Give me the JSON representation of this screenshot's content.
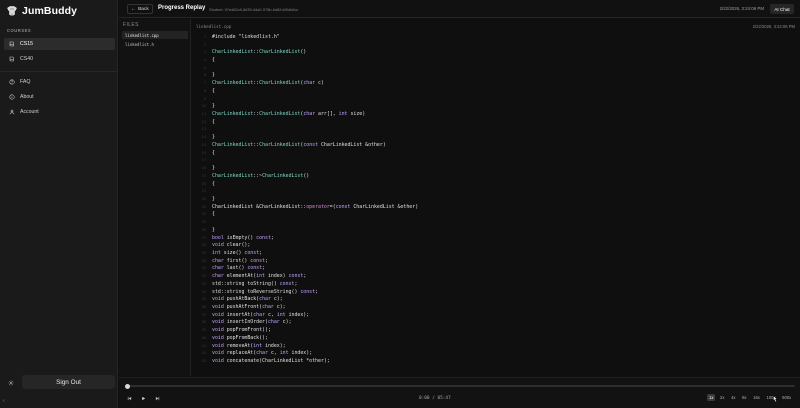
{
  "app": {
    "name": "JumBuddy"
  },
  "sidebar": {
    "section_label": "COURSES",
    "courses": [
      {
        "label": "CS15",
        "icon": "book-icon",
        "active": true
      },
      {
        "label": "CS40",
        "icon": "book-icon",
        "active": false
      }
    ],
    "links": [
      {
        "label": "FAQ",
        "icon": "help-circle-icon"
      },
      {
        "label": "About",
        "icon": "info-icon"
      },
      {
        "label": "Account",
        "icon": "user-icon"
      }
    ],
    "sign_out_label": "Sign Out",
    "settings_icon": "gear-icon",
    "collapse_icon": "chevron-left-icon"
  },
  "header": {
    "back_label": "Back",
    "title": "Progress Replay",
    "student_label": "Student: 97ed62c8-8d35-4da2-978b-bd82d49db8cc",
    "timestamp": "2/22/2026, 3:24:06 PM",
    "ai_chat_label": "AI Chat"
  },
  "files": {
    "label": "FILES",
    "items": [
      {
        "name": "linkedlist.cpp",
        "active": true
      },
      {
        "name": "linkedlist.h",
        "active": false
      }
    ]
  },
  "editor": {
    "filename": "linkedlist.cpp",
    "timestamp": "2/22/2026, 3:24:06 PM",
    "lines": [
      [
        [
          "tx",
          "#include \"linkedlist.h\""
        ]
      ],
      [],
      [
        [
          "ty",
          "CharLinkedList"
        ],
        [
          "tx",
          "::"
        ],
        [
          "ty",
          "CharLinkedList"
        ],
        [
          "tx",
          "()"
        ]
      ],
      [
        [
          "tx",
          "{"
        ]
      ],
      [],
      [
        [
          "tx",
          "}"
        ]
      ],
      [
        [
          "ty",
          "CharLinkedList"
        ],
        [
          "tx",
          "::"
        ],
        [
          "ty",
          "CharLinkedList"
        ],
        [
          "tx",
          "("
        ],
        [
          "kw",
          "char"
        ],
        [
          "tx",
          " c)"
        ]
      ],
      [
        [
          "tx",
          "{"
        ]
      ],
      [],
      [
        [
          "tx",
          "}"
        ]
      ],
      [
        [
          "ty",
          "CharLinkedList"
        ],
        [
          "tx",
          "::"
        ],
        [
          "ty",
          "CharLinkedList"
        ],
        [
          "tx",
          "("
        ],
        [
          "kw",
          "char"
        ],
        [
          "tx",
          " arr[], "
        ],
        [
          "kw",
          "int"
        ],
        [
          "tx",
          " size)"
        ]
      ],
      [
        [
          "tx",
          "{"
        ]
      ],
      [],
      [
        [
          "tx",
          "}"
        ]
      ],
      [
        [
          "ty",
          "CharLinkedList"
        ],
        [
          "tx",
          "::"
        ],
        [
          "ty",
          "CharLinkedList"
        ],
        [
          "tx",
          "("
        ],
        [
          "kw",
          "const"
        ],
        [
          "tx",
          " CharLinkedList &other)"
        ]
      ],
      [
        [
          "tx",
          "{"
        ]
      ],
      [],
      [
        [
          "tx",
          "}"
        ]
      ],
      [
        [
          "ty",
          "CharLinkedList"
        ],
        [
          "tx",
          "::~"
        ],
        [
          "ty",
          "CharLinkedList"
        ],
        [
          "tx",
          "()"
        ]
      ],
      [
        [
          "tx",
          "{"
        ]
      ],
      [],
      [
        [
          "tx",
          "}"
        ]
      ],
      [
        [
          "tx",
          "CharLinkedList &CharLinkedList::"
        ],
        [
          "op",
          "operator"
        ],
        [
          "tx",
          "=("
        ],
        [
          "kw",
          "const"
        ],
        [
          "tx",
          " CharLinkedList &other)"
        ]
      ],
      [
        [
          "tx",
          "{"
        ]
      ],
      [],
      [
        [
          "tx",
          "}"
        ]
      ],
      [
        [
          "kw",
          "bool"
        ],
        [
          "tx",
          " isEmpty() "
        ],
        [
          "kw",
          "const"
        ],
        [
          "tx",
          ";"
        ]
      ],
      [
        [
          "kw",
          "void"
        ],
        [
          "tx",
          " clear();"
        ]
      ],
      [
        [
          "kw",
          "int"
        ],
        [
          "tx",
          " size() "
        ],
        [
          "kw",
          "const"
        ],
        [
          "tx",
          ";"
        ]
      ],
      [
        [
          "kw",
          "char"
        ],
        [
          "tx",
          " first() "
        ],
        [
          "kw",
          "const"
        ],
        [
          "tx",
          ";"
        ]
      ],
      [
        [
          "kw",
          "char"
        ],
        [
          "tx",
          " last() "
        ],
        [
          "kw",
          "const"
        ],
        [
          "tx",
          ";"
        ]
      ],
      [
        [
          "kw",
          "char"
        ],
        [
          "tx",
          " elementAt("
        ],
        [
          "kw",
          "int"
        ],
        [
          "tx",
          " index) "
        ],
        [
          "kw",
          "const"
        ],
        [
          "tx",
          ";"
        ]
      ],
      [
        [
          "tx",
          "std::string toString() "
        ],
        [
          "kw",
          "const"
        ],
        [
          "tx",
          ";"
        ]
      ],
      [
        [
          "tx",
          "std::string toReverseString() "
        ],
        [
          "kw",
          "const"
        ],
        [
          "tx",
          ";"
        ]
      ],
      [
        [
          "kw",
          "void"
        ],
        [
          "tx",
          " pushAtBack("
        ],
        [
          "kw",
          "char"
        ],
        [
          "tx",
          " c);"
        ]
      ],
      [
        [
          "kw",
          "void"
        ],
        [
          "tx",
          " pushAtFront("
        ],
        [
          "kw",
          "char"
        ],
        [
          "tx",
          " c);"
        ]
      ],
      [
        [
          "kw",
          "void"
        ],
        [
          "tx",
          " insertAt("
        ],
        [
          "kw",
          "char"
        ],
        [
          "tx",
          " c, "
        ],
        [
          "kw",
          "int"
        ],
        [
          "tx",
          " index);"
        ]
      ],
      [
        [
          "kw",
          "void"
        ],
        [
          "tx",
          " insertInOrder("
        ],
        [
          "kw",
          "char"
        ],
        [
          "tx",
          " c);"
        ]
      ],
      [
        [
          "kw",
          "void"
        ],
        [
          "tx",
          " popFromFront();"
        ]
      ],
      [
        [
          "kw",
          "void"
        ],
        [
          "tx",
          " popFromBack();"
        ]
      ],
      [
        [
          "kw",
          "void"
        ],
        [
          "tx",
          " removeAt("
        ],
        [
          "kw",
          "int"
        ],
        [
          "tx",
          " index);"
        ]
      ],
      [
        [
          "kw",
          "void"
        ],
        [
          "tx",
          " replaceAt("
        ],
        [
          "kw",
          "char"
        ],
        [
          "tx",
          " c, "
        ],
        [
          "kw",
          "int"
        ],
        [
          "tx",
          " index);"
        ]
      ],
      [
        [
          "kw",
          "void"
        ],
        [
          "tx",
          " concatenate(CharLinkedList *other);"
        ]
      ]
    ]
  },
  "player": {
    "time_readout": "0:00 / 05:47",
    "progress_fraction": 0,
    "speeds": [
      "1x",
      "2x",
      "4x",
      "8x",
      "16x",
      "100x",
      "500x"
    ],
    "active_speed": "1x",
    "controls": [
      "skip-back-icon",
      "play-icon",
      "skip-forward-icon"
    ]
  },
  "colors": {
    "background": "#0f0f0f",
    "sidebar": "#1a1a1a",
    "keyword": "#c4a3ff",
    "type": "#7ed8c8",
    "operator": "#d68bd6"
  }
}
